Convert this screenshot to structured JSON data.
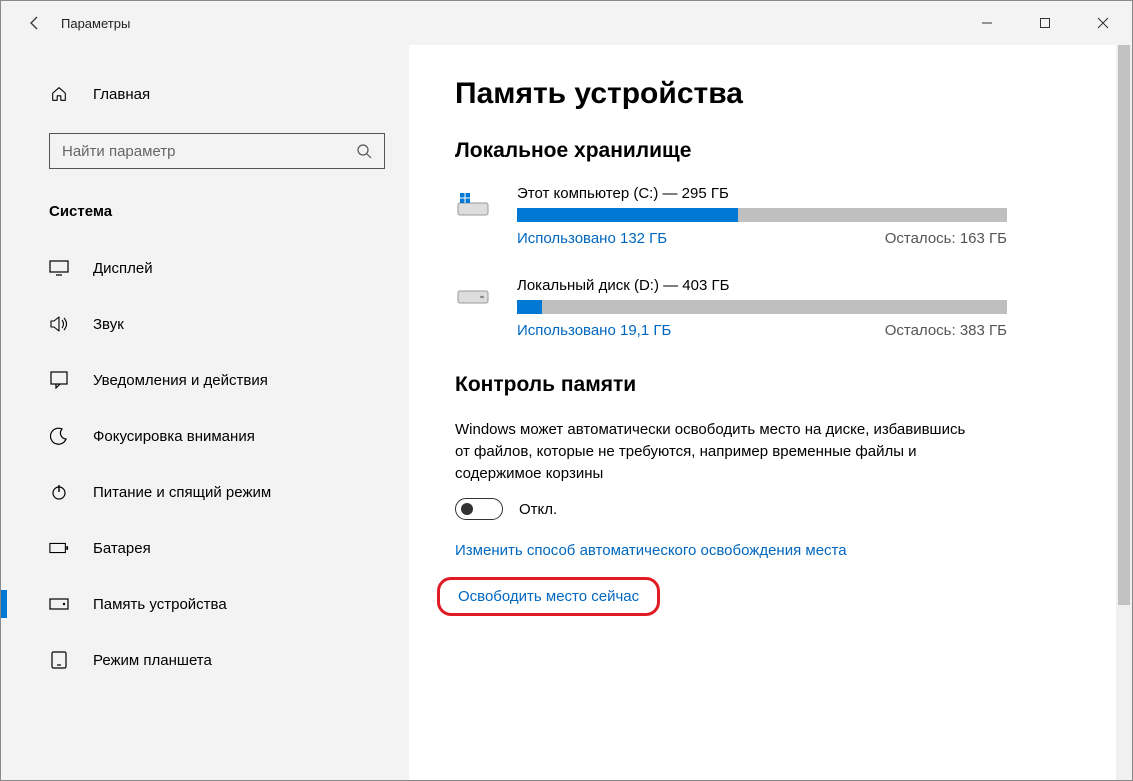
{
  "window": {
    "title": "Параметры"
  },
  "sidebar": {
    "home": "Главная",
    "search_placeholder": "Найти параметр",
    "section": "Система",
    "items": [
      {
        "label": "Дисплей"
      },
      {
        "label": "Звук"
      },
      {
        "label": "Уведомления и действия"
      },
      {
        "label": "Фокусировка внимания"
      },
      {
        "label": "Питание и спящий режим"
      },
      {
        "label": "Батарея"
      },
      {
        "label": "Память устройства"
      },
      {
        "label": "Режим планшета"
      }
    ],
    "selected_index": 6
  },
  "main": {
    "title": "Память устройства",
    "local_storage_heading": "Локальное хранилище",
    "drives": [
      {
        "title": "Этот компьютер (C:) — 295 ГБ",
        "used_label": "Использовано 132 ГБ",
        "free_label": "Осталось: 163 ГБ",
        "fill_percent": 45
      },
      {
        "title": "Локальный диск (D:) — 403 ГБ",
        "used_label": "Использовано 19,1 ГБ",
        "free_label": "Осталось: 383 ГБ",
        "fill_percent": 5
      }
    ],
    "sense_heading": "Контроль памяти",
    "sense_desc": "Windows может автоматически освободить место на диске, избавившись от файлов, которые не требуются, например временные файлы и содержимое корзины",
    "toggle_label": "Откл.",
    "link_change": "Изменить способ автоматического освобождения места",
    "link_free_now": "Освободить место сейчас"
  }
}
